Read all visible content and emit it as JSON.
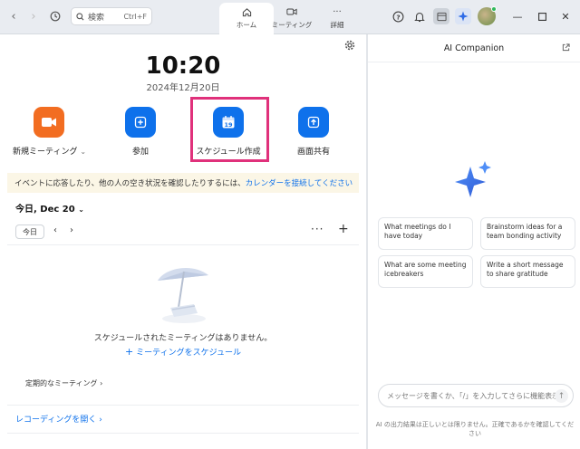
{
  "titlebar": {
    "search_placeholder": "検索",
    "search_shortcut": "Ctrl+F",
    "tabs": [
      {
        "label": "ホーム",
        "icon": "home-icon",
        "active": true
      },
      {
        "label": "ミーティング",
        "icon": "camera-icon",
        "active": false
      },
      {
        "label": "詳細",
        "icon": "more-icon",
        "active": false
      }
    ]
  },
  "home": {
    "time": "10:20",
    "date": "2024年12月20日",
    "actions": [
      {
        "label": "新規ミーティング",
        "icon": "video-camera-icon",
        "color": "#f26d21"
      },
      {
        "label": "参加",
        "icon": "plus-icon",
        "color": "#0e71eb"
      },
      {
        "label": "スケジュール作成",
        "icon": "calendar-icon",
        "color": "#0e71eb",
        "calendar_day": "19"
      },
      {
        "label": "画面共有",
        "icon": "share-screen-icon",
        "color": "#0e71eb"
      }
    ],
    "banner_text": "イベントに応答したり、他の人の空き状況を確認したりするには、",
    "banner_link": "カレンダーを接続してください",
    "today_label": "今日, Dec 20",
    "today_button": "今日",
    "empty_text": "スケジュールされたミーティングはありません。",
    "schedule_link": "ミーティングをスケジュール",
    "recurring_label": "定期的なミーティング",
    "recording_link": "レコーディングを開く"
  },
  "ai": {
    "title": "AI Companion",
    "suggestions": [
      "What meetings do I have today",
      "Brainstorm ideas for a team bonding activity",
      "What are some meeting icebreakers",
      "Write a short message to share gratitude"
    ],
    "input_placeholder": "メッセージを書くか、「/」を入力してさらに機能表示",
    "disclaimer": "AI の出力結果は正しいとは限りません。正確であるかを確認してください"
  },
  "colors": {
    "accent": "#0e71eb",
    "new_meeting": "#f26d21",
    "highlight": "#e0317b"
  }
}
